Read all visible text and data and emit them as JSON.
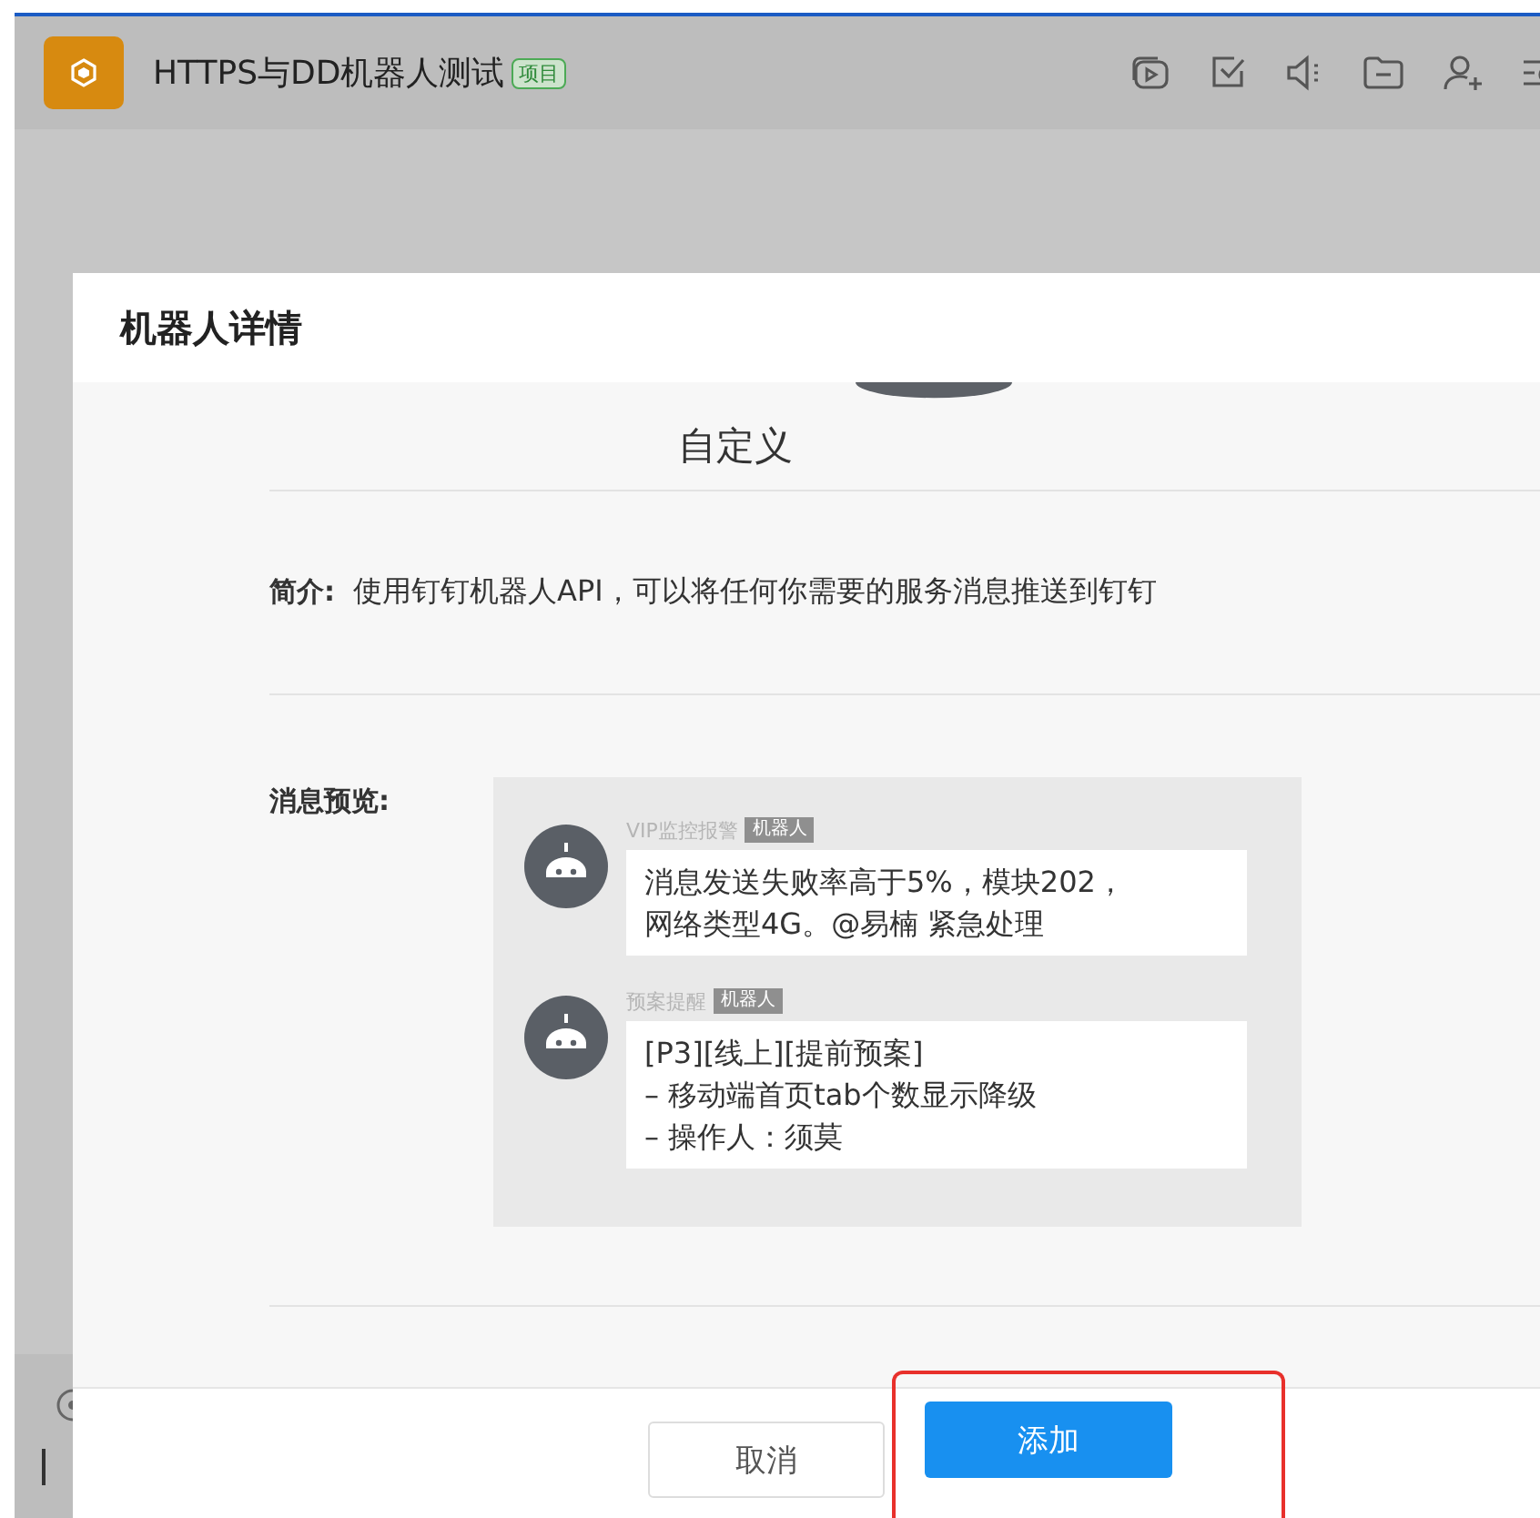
{
  "header": {
    "title": "HTTPS与DD机器人测试",
    "tag": "项目"
  },
  "dialog": {
    "title": "机器人详情",
    "robot_name": "自定义",
    "intro": {
      "label": "简介:",
      "text": "使用钉钉机器人API，可以将任何你需要的服务消息推送到钉钉"
    },
    "preview": {
      "label": "消息预览:",
      "messages": [
        {
          "sender": "VIP监控报警",
          "badge": "机器人",
          "lines": [
            "消息发送失败率高于5%，模块202，",
            "网络类型4G。@易楠 紧急处理"
          ]
        },
        {
          "sender": "预案提醒",
          "badge": "机器人",
          "lines": [
            "[P3][线上][提前预案]",
            "– 移动端首页tab个数显示降级",
            "– 操作人：须莫"
          ]
        }
      ]
    },
    "buttons": [
      {
        "label": "取消",
        "kind": "secondary",
        "highlighted": false
      },
      {
        "label": "添加",
        "kind": "primary",
        "highlighted": true
      }
    ]
  }
}
